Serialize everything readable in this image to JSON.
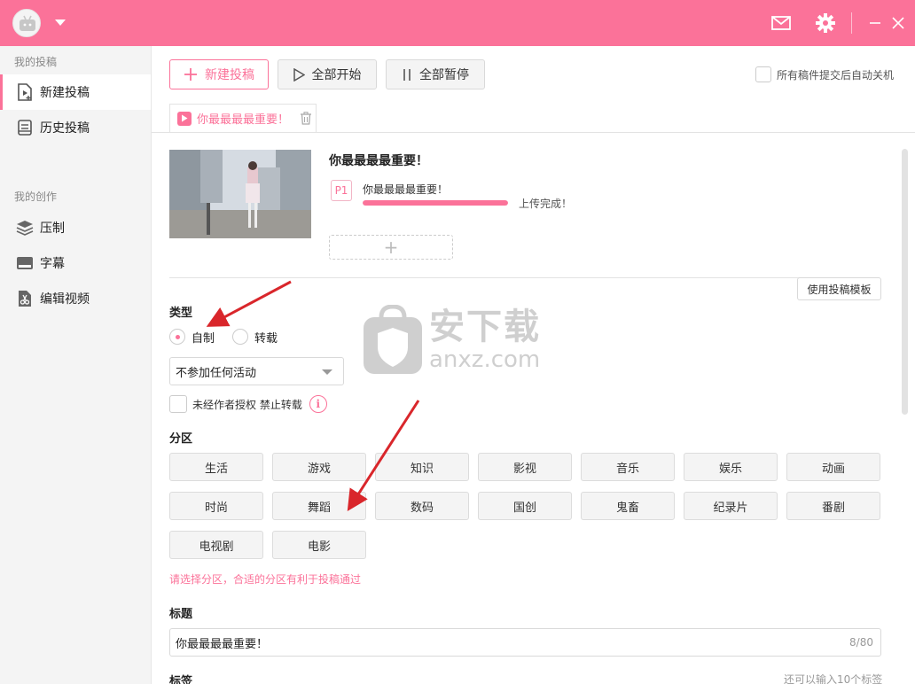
{
  "header": {
    "avatar_icon": "bilibili-tv-icon",
    "dropdown_icon": "caret-down-icon",
    "mail_icon": "mail-icon",
    "settings_icon": "gear-icon",
    "minimize_icon": "minimize-icon",
    "close_icon": "close-icon",
    "brand_color": "#fb7299"
  },
  "sidebar": {
    "group1": "我的投稿",
    "new_submission": "新建投稿",
    "history_submission": "历史投稿",
    "group2": "我的创作",
    "compress": "压制",
    "subtitles": "字幕",
    "edit_video": "编辑视频"
  },
  "toolbar": {
    "new_button": "新建投稿",
    "start_all": "全部开始",
    "pause_all": "全部暂停",
    "auto_shutdown": "所有稿件提交后自动关机"
  },
  "tab": {
    "label": "你最最最最重要！"
  },
  "video": {
    "title": "你最最最最重要！",
    "part_badge": "P1",
    "part_name": "你最最最最重要！",
    "progress": 1.0,
    "status": "上传完成！",
    "add_part": "+"
  },
  "form": {
    "use_template": "使用投稿模板",
    "type_label": "类型",
    "type_original": "自制",
    "type_repost": "转载",
    "activity_select": "不参加任何活动",
    "no_repost": "未经作者授权 禁止转载",
    "info_icon": "i",
    "zone_label": "分区",
    "zones": [
      "生活",
      "游戏",
      "知识",
      "影视",
      "音乐",
      "娱乐",
      "动画",
      "时尚",
      "舞蹈",
      "数码",
      "国创",
      "鬼畜",
      "纪录片",
      "番剧",
      "电视剧",
      "电影"
    ],
    "zone_hint": "请选择分区，合适的分区有利于投稿通过",
    "title_label": "标题",
    "title_value": "你最最最最重要！",
    "title_count": "8/80",
    "tags_label": "标签",
    "tags_hint": "还可以输入10个标签"
  },
  "watermark": {
    "cn": "安下载",
    "en": "anxz.com",
    "shield_char": "安"
  }
}
